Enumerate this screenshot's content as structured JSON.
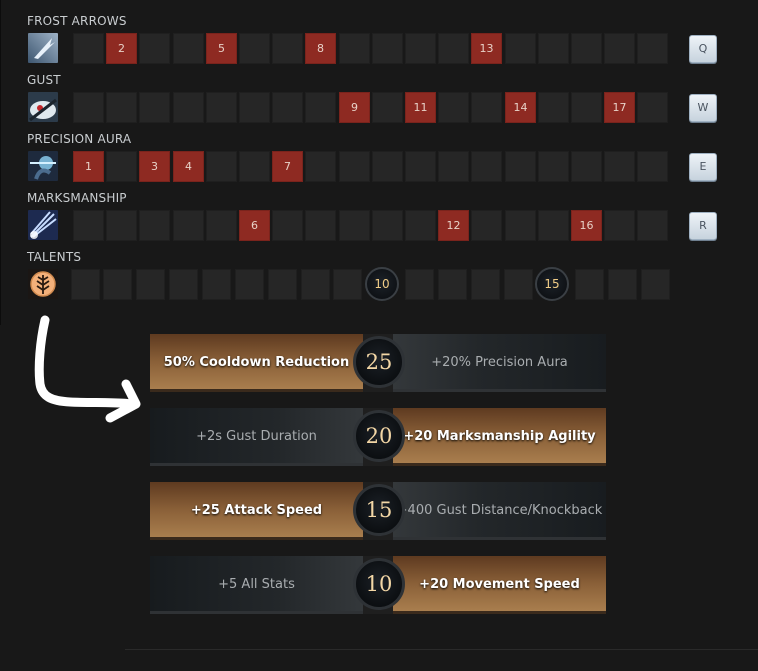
{
  "abilities": [
    {
      "name": "FROST ARROWS",
      "icon": "frost-arrows-icon",
      "key": "Q",
      "levels": [
        2,
        5,
        8,
        13
      ]
    },
    {
      "name": "GUST",
      "icon": "gust-icon",
      "key": "W",
      "levels": [
        9,
        11,
        14,
        17
      ]
    },
    {
      "name": "PRECISION AURA",
      "icon": "precision-aura-icon",
      "key": "E",
      "levels": [
        1,
        3,
        4,
        7
      ]
    },
    {
      "name": "MARKSMANSHIP",
      "icon": "marksmanship-icon",
      "key": "R",
      "levels": [
        6,
        12,
        16
      ]
    }
  ],
  "talents_row": {
    "name": "TALENTS",
    "icon": "talent-tree-icon",
    "levels": [
      10,
      15
    ]
  },
  "total_levels": 18,
  "talent_tree": [
    {
      "level": "25",
      "left": "50% Cooldown Reduction",
      "right": "+20% Precision Aura",
      "chosen": "left"
    },
    {
      "level": "20",
      "left": "+2s Gust Duration",
      "right": "+20 Marksmanship Agility",
      "chosen": "right"
    },
    {
      "level": "15",
      "left": "+25 Attack Speed",
      "right": "+400 Gust Distance/Knockback",
      "chosen": "left"
    },
    {
      "level": "10",
      "left": "+5 All Stats",
      "right": "+20 Movement Speed",
      "chosen": "right"
    }
  ],
  "colors": {
    "picked": "#8e2a22",
    "chosen_talent": "#a97e4e",
    "badge_text": "#f0cc86"
  }
}
